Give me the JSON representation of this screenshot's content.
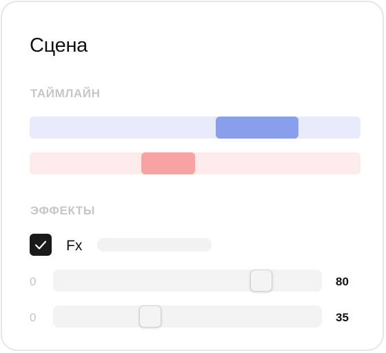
{
  "panel": {
    "title": "Сцена"
  },
  "timeline": {
    "label": "ТАЙМЛАЙН",
    "tracks": [
      {
        "track_color": "#e8ebfb",
        "clip_color": "#8a9eee",
        "clip_start": 0.5625,
        "clip_end": 0.8125
      },
      {
        "track_color": "#fdeaea",
        "clip_color": "#f7a3a3",
        "clip_start": 0.3375,
        "clip_end": 0.5
      }
    ]
  },
  "effects": {
    "label": "ЭФФЕКТЫ",
    "fx": {
      "checked": true,
      "label": "Fx",
      "value": ""
    },
    "sliders": [
      {
        "min_label": "0",
        "value": 80,
        "value_label": "80",
        "max": 100
      },
      {
        "min_label": "0",
        "value": 35,
        "value_label": "35",
        "max": 100
      }
    ]
  },
  "colors": {
    "checkbox": "#1a1a1a",
    "section_label": "#c6c6c6"
  }
}
